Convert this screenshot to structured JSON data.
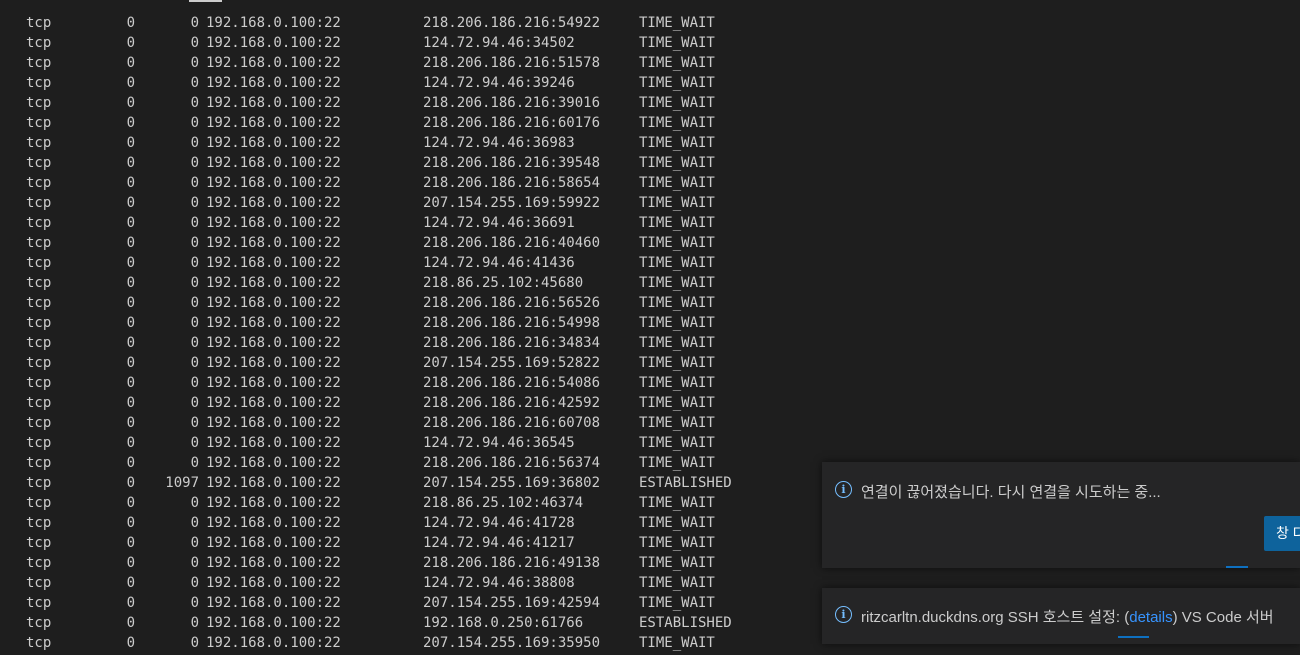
{
  "terminal": {
    "rows": [
      [
        "tcp",
        "0",
        "0",
        "192.168.0.100:22",
        "218.206.186.216:54922",
        "TIME_WAIT"
      ],
      [
        "tcp",
        "0",
        "0",
        "192.168.0.100:22",
        "124.72.94.46:34502",
        "TIME_WAIT"
      ],
      [
        "tcp",
        "0",
        "0",
        "192.168.0.100:22",
        "218.206.186.216:51578",
        "TIME_WAIT"
      ],
      [
        "tcp",
        "0",
        "0",
        "192.168.0.100:22",
        "124.72.94.46:39246",
        "TIME_WAIT"
      ],
      [
        "tcp",
        "0",
        "0",
        "192.168.0.100:22",
        "218.206.186.216:39016",
        "TIME_WAIT"
      ],
      [
        "tcp",
        "0",
        "0",
        "192.168.0.100:22",
        "218.206.186.216:60176",
        "TIME_WAIT"
      ],
      [
        "tcp",
        "0",
        "0",
        "192.168.0.100:22",
        "124.72.94.46:36983",
        "TIME_WAIT"
      ],
      [
        "tcp",
        "0",
        "0",
        "192.168.0.100:22",
        "218.206.186.216:39548",
        "TIME_WAIT"
      ],
      [
        "tcp",
        "0",
        "0",
        "192.168.0.100:22",
        "218.206.186.216:58654",
        "TIME_WAIT"
      ],
      [
        "tcp",
        "0",
        "0",
        "192.168.0.100:22",
        "207.154.255.169:59922",
        "TIME_WAIT"
      ],
      [
        "tcp",
        "0",
        "0",
        "192.168.0.100:22",
        "124.72.94.46:36691",
        "TIME_WAIT"
      ],
      [
        "tcp",
        "0",
        "0",
        "192.168.0.100:22",
        "218.206.186.216:40460",
        "TIME_WAIT"
      ],
      [
        "tcp",
        "0",
        "0",
        "192.168.0.100:22",
        "124.72.94.46:41436",
        "TIME_WAIT"
      ],
      [
        "tcp",
        "0",
        "0",
        "192.168.0.100:22",
        "218.86.25.102:45680",
        "TIME_WAIT"
      ],
      [
        "tcp",
        "0",
        "0",
        "192.168.0.100:22",
        "218.206.186.216:56526",
        "TIME_WAIT"
      ],
      [
        "tcp",
        "0",
        "0",
        "192.168.0.100:22",
        "218.206.186.216:54998",
        "TIME_WAIT"
      ],
      [
        "tcp",
        "0",
        "0",
        "192.168.0.100:22",
        "218.206.186.216:34834",
        "TIME_WAIT"
      ],
      [
        "tcp",
        "0",
        "0",
        "192.168.0.100:22",
        "207.154.255.169:52822",
        "TIME_WAIT"
      ],
      [
        "tcp",
        "0",
        "0",
        "192.168.0.100:22",
        "218.206.186.216:54086",
        "TIME_WAIT"
      ],
      [
        "tcp",
        "0",
        "0",
        "192.168.0.100:22",
        "218.206.186.216:42592",
        "TIME_WAIT"
      ],
      [
        "tcp",
        "0",
        "0",
        "192.168.0.100:22",
        "218.206.186.216:60708",
        "TIME_WAIT"
      ],
      [
        "tcp",
        "0",
        "0",
        "192.168.0.100:22",
        "124.72.94.46:36545",
        "TIME_WAIT"
      ],
      [
        "tcp",
        "0",
        "0",
        "192.168.0.100:22",
        "218.206.186.216:56374",
        "TIME_WAIT"
      ],
      [
        "tcp",
        "0",
        "1097",
        "192.168.0.100:22",
        "207.154.255.169:36802",
        "ESTABLISHED"
      ],
      [
        "tcp",
        "0",
        "0",
        "192.168.0.100:22",
        "218.86.25.102:46374",
        "TIME_WAIT"
      ],
      [
        "tcp",
        "0",
        "0",
        "192.168.0.100:22",
        "124.72.94.46:41728",
        "TIME_WAIT"
      ],
      [
        "tcp",
        "0",
        "0",
        "192.168.0.100:22",
        "124.72.94.46:41217",
        "TIME_WAIT"
      ],
      [
        "tcp",
        "0",
        "0",
        "192.168.0.100:22",
        "218.206.186.216:49138",
        "TIME_WAIT"
      ],
      [
        "tcp",
        "0",
        "0",
        "192.168.0.100:22",
        "124.72.94.46:38808",
        "TIME_WAIT"
      ],
      [
        "tcp",
        "0",
        "0",
        "192.168.0.100:22",
        "207.154.255.169:42594",
        "TIME_WAIT"
      ],
      [
        "tcp",
        "0",
        "0",
        "192.168.0.100:22",
        "192.168.0.250:61766",
        "ESTABLISHED"
      ],
      [
        "tcp",
        "0",
        "0",
        "192.168.0.100:22",
        "207.154.255.169:35950",
        "TIME_WAIT"
      ]
    ]
  },
  "notifications": [
    {
      "icon": "info-icon",
      "message": "연결이 끊어졌습니다. 다시 연결을 시도하는 중...",
      "action_label": "창 다"
    },
    {
      "icon": "info-icon",
      "message_prefix": "ritzcarltn.duckdns.org SSH 호스트 설정: (",
      "link_label": "details",
      "message_suffix": ") VS Code 서버"
    }
  ],
  "colors": {
    "terminal_bg": "#1e1e1e",
    "terminal_fg": "#cccccc",
    "toast_bg": "#252526",
    "button_bg": "#0e639c",
    "link": "#3794ff",
    "info_icon": "#75beff"
  }
}
